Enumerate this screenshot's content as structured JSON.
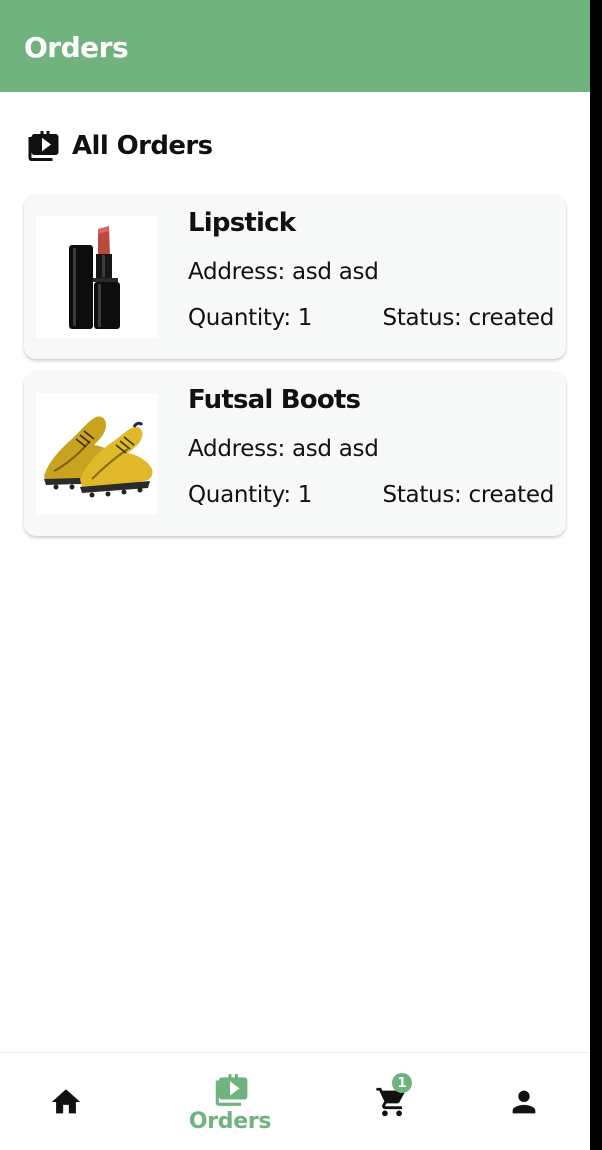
{
  "appbar": {
    "title": "Orders",
    "color": "#71b37f"
  },
  "section": {
    "title": "All Orders",
    "icon": "orders-bag-icon"
  },
  "orders": [
    {
      "name": "Lipstick",
      "address": "Address: asd asd",
      "quantity": "Quantity: 1",
      "status": "Status: created",
      "image": "lipstick-image"
    },
    {
      "name": "Futsal Boots",
      "address": "Address: asd asd",
      "quantity": "Quantity: 1",
      "status": "Status: created",
      "image": "futsal-boots-image"
    }
  ],
  "bottom_nav": {
    "items": [
      {
        "icon": "home-icon",
        "label": ""
      },
      {
        "icon": "orders-icon",
        "label": "Orders",
        "active": true
      },
      {
        "icon": "cart-icon",
        "label": "",
        "badge": "1"
      },
      {
        "icon": "person-icon",
        "label": ""
      }
    ]
  }
}
